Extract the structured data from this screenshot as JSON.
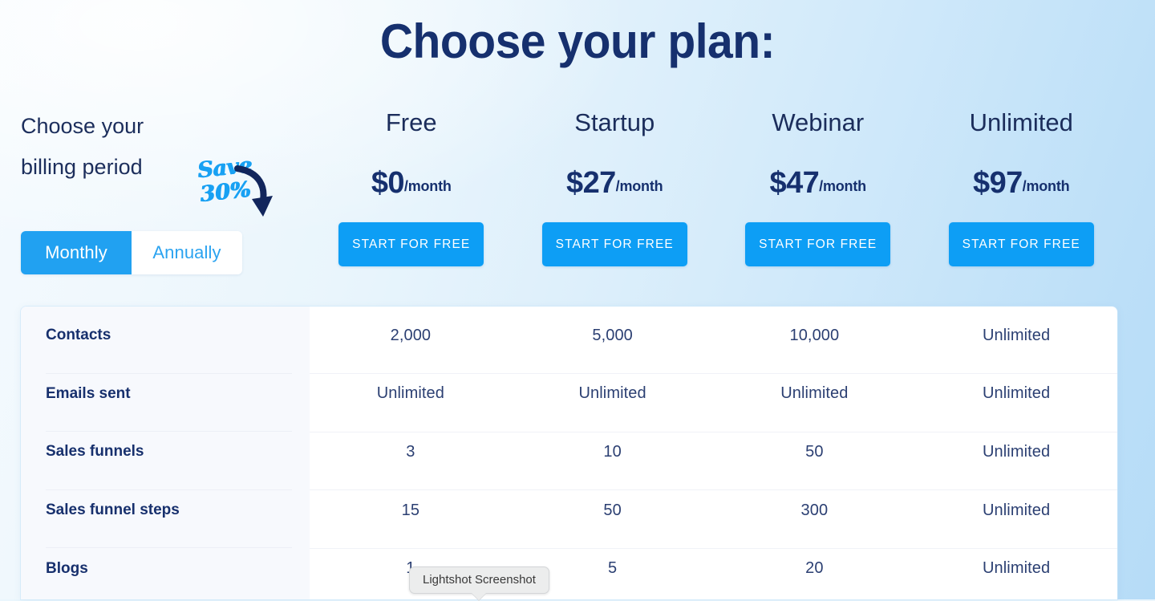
{
  "headline": "Choose your plan:",
  "billing": {
    "label_line1": "Choose your",
    "label_line2": "billing period",
    "save_line1": "Save",
    "save_line2": "30%",
    "arrow_icon": "curved-arrow-icon",
    "options": [
      {
        "label": "Monthly",
        "state": "active"
      },
      {
        "label": "Annually",
        "state": "inactive"
      }
    ],
    "selected": "Monthly"
  },
  "plans": [
    {
      "name": "Free",
      "price": "$0",
      "period": "/month",
      "cta": "START FOR FREE"
    },
    {
      "name": "Startup",
      "price": "$27",
      "period": "/month",
      "cta": "START FOR FREE"
    },
    {
      "name": "Webinar",
      "price": "$47",
      "period": "/month",
      "cta": "START FOR FREE"
    },
    {
      "name": "Unlimited",
      "price": "$97",
      "period": "/month",
      "cta": "START FOR FREE"
    }
  ],
  "comparison": {
    "rows": [
      {
        "feature": "Contacts",
        "values": [
          "2,000",
          "5,000",
          "10,000",
          "Unlimited"
        ]
      },
      {
        "feature": "Emails sent",
        "values": [
          "Unlimited",
          "Unlimited",
          "Unlimited",
          "Unlimited"
        ]
      },
      {
        "feature": "Sales funnels",
        "values": [
          "3",
          "10",
          "50",
          "Unlimited"
        ]
      },
      {
        "feature": "Sales funnel steps",
        "values": [
          "15",
          "50",
          "300",
          "Unlimited"
        ]
      },
      {
        "feature": "Blogs",
        "values": [
          "1",
          "5",
          "20",
          "Unlimited"
        ]
      }
    ]
  },
  "tooltip": {
    "text": "Lightshot Screenshot"
  },
  "colors": {
    "headline_navy": "#16306e",
    "accent_blue": "#0d9ef5",
    "toggle_active_blue": "#21a1f1",
    "toggle_inactive_text": "#2ba3f0",
    "save_blue": "#18a1f3",
    "arrow_navy": "#12265c",
    "table_label_navy": "#17306d",
    "table_value_navy": "#2b3f72",
    "card_white": "#ffffff",
    "label_col_bg": "#f7f9fd"
  }
}
